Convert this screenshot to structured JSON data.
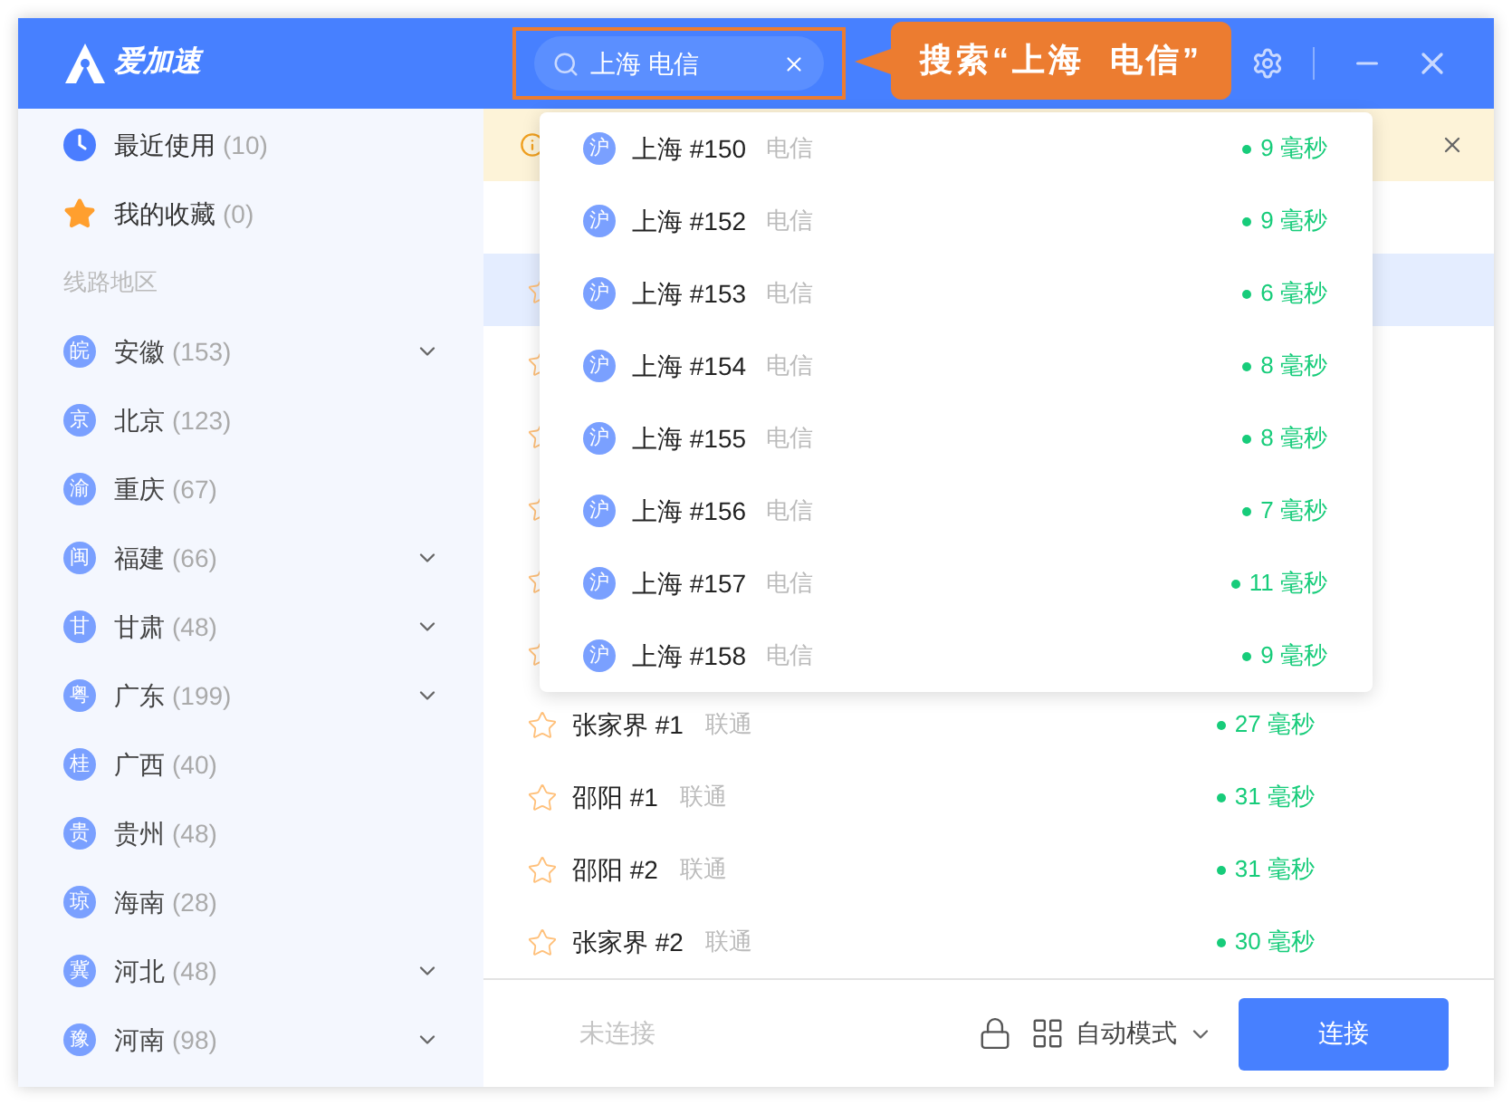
{
  "app": {
    "name": "爱加速"
  },
  "search": {
    "value": "上海 电信"
  },
  "callout": {
    "text": "搜索“上海  电信”"
  },
  "sidebar": {
    "quick": [
      {
        "kind": "clock",
        "label": "最近使用",
        "count": "(10)"
      },
      {
        "kind": "star",
        "label": "我的收藏",
        "count": "(0)"
      }
    ],
    "section_title": "线路地区",
    "regions": [
      {
        "badge": "皖",
        "name": "安徽",
        "count": "(153)",
        "expandable": true
      },
      {
        "badge": "京",
        "name": "北京",
        "count": "(123)",
        "expandable": false
      },
      {
        "badge": "渝",
        "name": "重庆",
        "count": "(67)",
        "expandable": false
      },
      {
        "badge": "闽",
        "name": "福建",
        "count": "(66)",
        "expandable": true
      },
      {
        "badge": "甘",
        "name": "甘肃",
        "count": "(48)",
        "expandable": true
      },
      {
        "badge": "粤",
        "name": "广东",
        "count": "(199)",
        "expandable": true
      },
      {
        "badge": "桂",
        "name": "广西",
        "count": "(40)",
        "expandable": false
      },
      {
        "badge": "贵",
        "name": "贵州",
        "count": "(48)",
        "expandable": false
      },
      {
        "badge": "琼",
        "name": "海南",
        "count": "(28)",
        "expandable": false
      },
      {
        "badge": "冀",
        "name": "河北",
        "count": "(48)",
        "expandable": true
      },
      {
        "badge": "豫",
        "name": "河南",
        "count": "(98)",
        "expandable": true
      }
    ]
  },
  "notice": {
    "closable": true
  },
  "servers": [
    {
      "selected": true,
      "favorite": false
    },
    {
      "selected": false,
      "favorite": false
    },
    {
      "selected": false,
      "favorite": false
    },
    {
      "selected": false,
      "favorite": false
    },
    {
      "selected": false,
      "favorite": false
    },
    {
      "selected": false,
      "favorite": false
    },
    {
      "selected": false,
      "favorite": false,
      "name": "张家界 #1",
      "carrier": "联通",
      "latency": "27 毫秒"
    },
    {
      "selected": false,
      "favorite": false,
      "name": "邵阳 #1",
      "carrier": "联通",
      "latency": "31 毫秒"
    },
    {
      "selected": false,
      "favorite": false,
      "name": "邵阳 #2",
      "carrier": "联通",
      "latency": "31 毫秒"
    },
    {
      "selected": false,
      "favorite": false,
      "name": "张家界 #2",
      "carrier": "联通",
      "latency": "30 毫秒"
    }
  ],
  "suggestions": [
    {
      "badge": "沪",
      "name": "上海 #150",
      "carrier": "电信",
      "latency": "9 毫秒"
    },
    {
      "badge": "沪",
      "name": "上海 #152",
      "carrier": "电信",
      "latency": "9 毫秒"
    },
    {
      "badge": "沪",
      "name": "上海 #153",
      "carrier": "电信",
      "latency": "6 毫秒"
    },
    {
      "badge": "沪",
      "name": "上海 #154",
      "carrier": "电信",
      "latency": "8 毫秒"
    },
    {
      "badge": "沪",
      "name": "上海 #155",
      "carrier": "电信",
      "latency": "8 毫秒"
    },
    {
      "badge": "沪",
      "name": "上海 #156",
      "carrier": "电信",
      "latency": "7 毫秒"
    },
    {
      "badge": "沪",
      "name": "上海 #157",
      "carrier": "电信",
      "latency": "11 毫秒"
    },
    {
      "badge": "沪",
      "name": "上海 #158",
      "carrier": "电信",
      "latency": "9 毫秒"
    }
  ],
  "footer": {
    "status": "未连接",
    "mode": "自动模式",
    "connect": "连接"
  }
}
